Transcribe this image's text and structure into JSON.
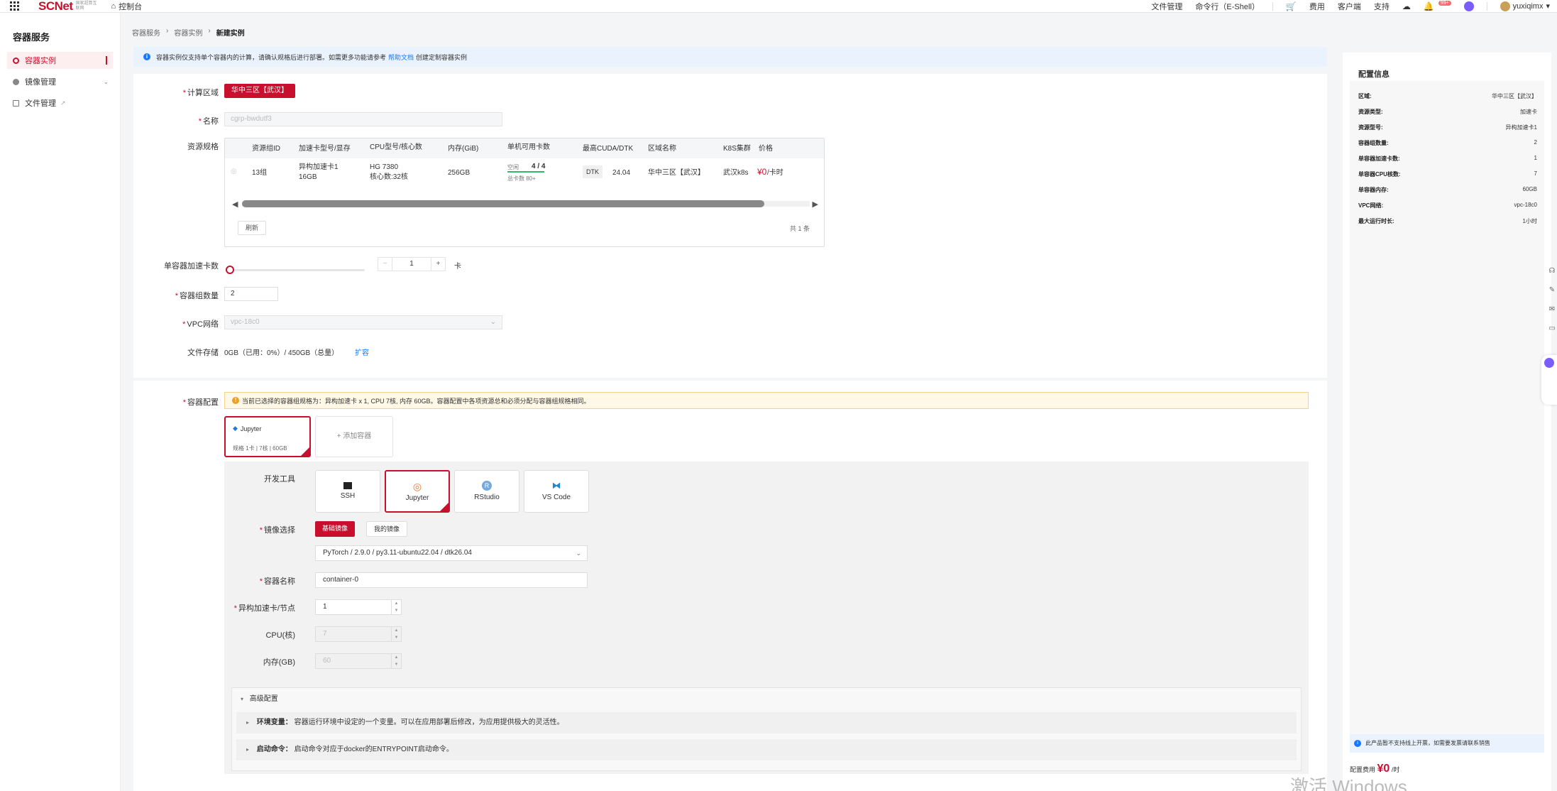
{
  "topbar": {
    "logo": "SCNet",
    "logo_sub": "国家超算互联网",
    "home": "控制台",
    "links": [
      "文件管理",
      "命令行（E-Shell）"
    ],
    "right_links": [
      "费用",
      "客户端",
      "支持"
    ],
    "badge": "99+",
    "user": "yuxiqimx"
  },
  "sidebar": {
    "title": "容器服务",
    "items": [
      {
        "label": "容器实例"
      },
      {
        "label": "镜像管理"
      },
      {
        "label": "文件管理"
      }
    ]
  },
  "breadcrumb": [
    "容器服务",
    "容器实例",
    "新建实例"
  ],
  "infobar": {
    "text_before": "容器实例仅支持单个容器内的计算，请确认规格后进行部署。如需更多功能请参考",
    "link": "帮助文档",
    "text_after": "创建定制容器实例"
  },
  "form": {
    "region_label": "计算区域",
    "region_value": "华中三区【武汉】",
    "name_label": "名称",
    "name_value": "cgrp-bwdutf3",
    "resource_label": "资源规格",
    "table_headers": [
      "资源组ID",
      "加速卡型号/显存",
      "CPU型号/核心数",
      "内存(GiB)",
      "单机可用卡数",
      "最高CUDA/DTK",
      "区域名称",
      "K8S集群",
      "价格"
    ],
    "row": {
      "id": "13组",
      "card": "异构加速卡1",
      "card2": "16GB",
      "cpu": "HG 7380",
      "cpu2": "核心数:32核",
      "mem": "256GB",
      "avail_label": "空闲",
      "avail_value": "4 / 4",
      "avail_sub": "总卡数 80+",
      "dtk": "DTK",
      "dtk_ver": "24.04",
      "region": "华中三区【武汉】",
      "k8s": "武汉k8s",
      "price": "¥0",
      "price_unit": "/卡时"
    },
    "refresh": "刷新",
    "total": "共 1 条",
    "cards_label": "单容器加速卡数",
    "cards_value": "1",
    "cards_unit": "卡",
    "count_label": "容器组数量",
    "count_value": "2",
    "vpc_label": "VPC网络",
    "vpc_value": "vpc-18c0",
    "storage_label": "文件存储",
    "storage_value": "0GB（已用：0%）/ 450GB（总量）",
    "storage_link": "扩容"
  },
  "container": {
    "label": "容器配置",
    "warn": "当前已选择的容器组规格为：异构加速卡 x 1, CPU 7核, 内存 60GB。容器配置中各项资源总和必须分配与容器组规格相同。",
    "card_name": "Jupyter",
    "card_meta": "规格   1卡 | 7核 | 60GB",
    "add": "+ 添加容器",
    "tool_label": "开发工具",
    "tools": [
      "SSH",
      "Jupyter",
      "RStudio",
      "VS Code"
    ],
    "image_label": "镜像选择",
    "image_basic": "基础镜像",
    "image_custom": "我的镜像",
    "image_value": "PyTorch / 2.9.0 / py3.11-ubuntu22.04 / dtk26.04",
    "cname_label": "容器名称",
    "cname_value": "container-0",
    "acc_label": "异构加速卡/节点",
    "acc_value": "1",
    "cpu_label": "CPU(核)",
    "cpu_value": "7",
    "mem_label": "内存(GB)",
    "mem_value": "60",
    "adv_title": "高级配置",
    "env_label": "环境变量：",
    "env_text": "容器运行环境中设定的一个变量。可以在应用部署后修改，为应用提供极大的灵活性。",
    "cmd_label": "启动命令：",
    "cmd_text": "启动命令对应于docker的ENTRYPOINT启动命令。"
  },
  "panel": {
    "title": "配置信息",
    "rows": [
      {
        "k": "区域:",
        "v": "华中三区【武汉】"
      },
      {
        "k": "资源类型:",
        "v": "加速卡"
      },
      {
        "k": "资源型号:",
        "v": "异构加速卡1"
      },
      {
        "k": "容器组数量:",
        "v": "2"
      },
      {
        "k": "单容器加速卡数:",
        "v": "1"
      },
      {
        "k": "单容器CPU核数:",
        "v": "7"
      },
      {
        "k": "单容器内存:",
        "v": "60GB"
      },
      {
        "k": "VPC网络:",
        "v": "vpc-18c0"
      },
      {
        "k": "最大运行时长:",
        "v": "1小时"
      }
    ],
    "notice": "此产品暂不支持线上开票，如需要发票请联系销售",
    "fee_label": "配置费用",
    "fee_value": "¥0",
    "fee_unit": "/时"
  },
  "watermark": "激活 Windows",
  "colors": {
    "brand": "#c8102e",
    "info": "#1677ff",
    "warn": "#f0a020"
  }
}
